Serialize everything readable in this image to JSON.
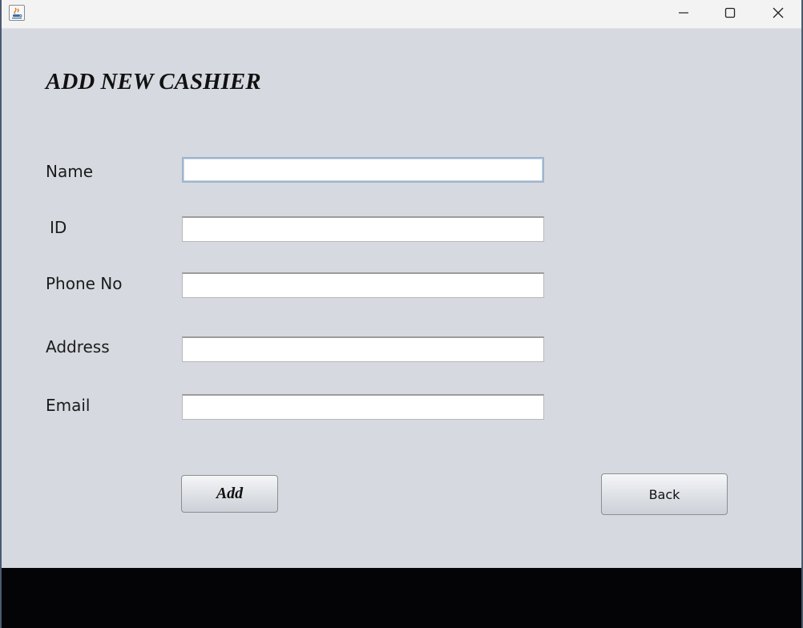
{
  "window": {
    "icon": "java-app-icon",
    "controls": {
      "minimize": "minimize-icon",
      "maximize": "maximize-icon",
      "close": "close-icon"
    }
  },
  "form": {
    "title": "ADD NEW CASHIER",
    "fields": {
      "name": {
        "label": "Name",
        "value": ""
      },
      "id": {
        "label": "ID",
        "value": ""
      },
      "phone": {
        "label": "Phone No",
        "value": ""
      },
      "address": {
        "label": "Address",
        "value": ""
      },
      "email": {
        "label": "Email",
        "value": ""
      }
    },
    "buttons": {
      "add": "Add",
      "back": "Back"
    }
  },
  "colors": {
    "background": "#d6d9e0",
    "focus_border": "#9db4cc",
    "bottom_bar": "#040406"
  }
}
